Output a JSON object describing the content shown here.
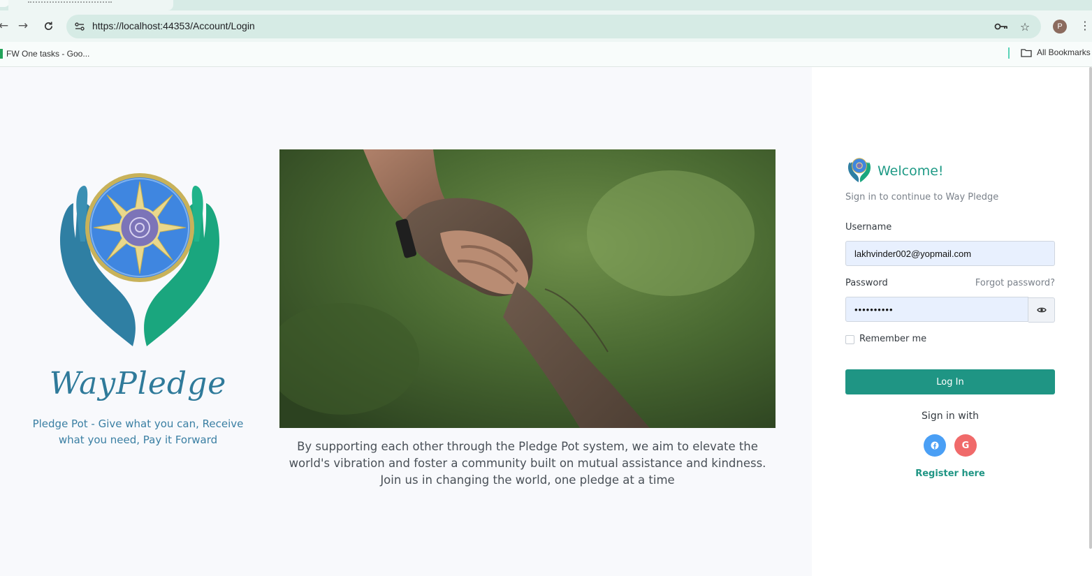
{
  "browser": {
    "url": "https://localhost:44353/Account/Login",
    "profile_initial": "P",
    "bookmarks": [
      {
        "label": "FW One tasks - Goo..."
      }
    ],
    "all_bookmarks_label": "All Bookmarks"
  },
  "brand": {
    "wordmark": "WayPledge",
    "tagline": "Pledge Pot - Give what you can, Receive what you need, Pay it Forward"
  },
  "hero": {
    "caption": "By supporting each other through the Pledge Pot system, we aim to elevate the world's vibration and foster a community built on mutual assistance and kindness. Join us in changing the world, one pledge at a time"
  },
  "login": {
    "title": "Welcome!",
    "subtitle": "Sign in to continue to Way Pledge",
    "username_label": "Username",
    "username_value": "lakhvinder002@yopmail.com",
    "password_label": "Password",
    "password_value": "••••••••••",
    "forgot_label": "Forgot password?",
    "remember_label": "Remember me",
    "login_button": "Log In",
    "sign_in_with": "Sign in with",
    "register_label": "Register here"
  },
  "colors": {
    "accent": "#1f9584",
    "facebook": "#4a9ff5",
    "google": "#f06a6a"
  }
}
